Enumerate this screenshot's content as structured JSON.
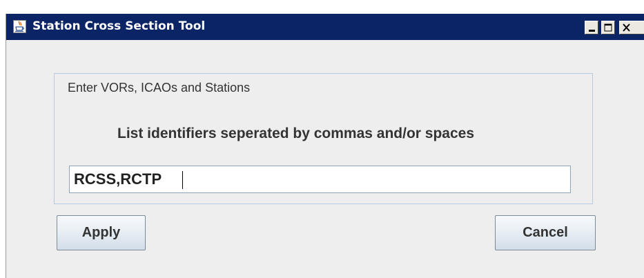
{
  "window": {
    "title": "Station Cross Section Tool",
    "controls": {
      "minimize_icon": "minimize-icon",
      "maximize_icon": "maximize-icon",
      "close_icon": "close-icon"
    },
    "title_bar_color": "#0b2466"
  },
  "group": {
    "legend": "Enter VORs, ICAOs and Stations",
    "instruction": "List identifiers seperated by commas and/or spaces",
    "input_value": "RCSS,RCTP"
  },
  "buttons": {
    "apply": "Apply",
    "cancel": "Cancel"
  }
}
